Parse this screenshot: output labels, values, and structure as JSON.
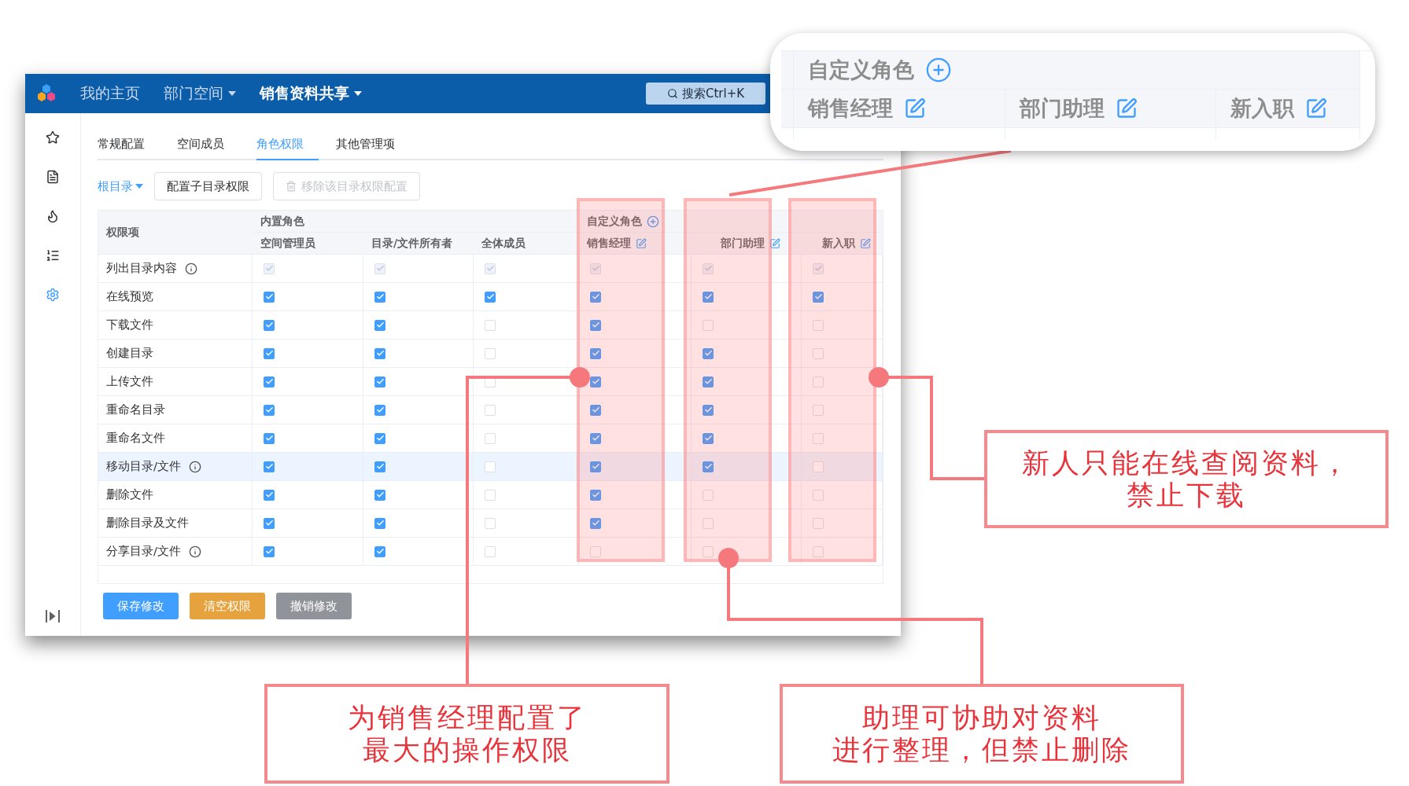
{
  "header": {
    "nav": [
      {
        "label": "我的主页",
        "selected": false,
        "dropdown": false
      },
      {
        "label": "部门空间",
        "selected": false,
        "dropdown": true
      },
      {
        "label": "销售资料共享",
        "selected": true,
        "dropdown": true
      }
    ],
    "search": "搜索Ctrl+K"
  },
  "sidebar": {
    "items": [
      {
        "kind": "star",
        "selected": false
      },
      {
        "kind": "document",
        "selected": false
      },
      {
        "kind": "flame",
        "selected": false
      },
      {
        "kind": "list",
        "selected": false
      },
      {
        "kind": "settings",
        "selected": true
      }
    ]
  },
  "tabs": [
    {
      "label": "常规配置",
      "selected": false
    },
    {
      "label": "空间成员",
      "selected": false
    },
    {
      "label": "角色权限",
      "selected": true
    },
    {
      "label": "其他管理项",
      "selected": false
    }
  ],
  "toolbar": {
    "directory": "根目录",
    "buttons": [
      {
        "label": "配置子目录权限",
        "disabled": false
      },
      {
        "label": "移除该目录权限配置",
        "disabled": true
      }
    ]
  },
  "table": {
    "row_header": "权限项",
    "groups": [
      {
        "title": "内置角色",
        "kind": "builtin"
      },
      {
        "title": "自定义角色",
        "kind": "custom"
      }
    ],
    "columns": [
      {
        "label": "空间管理员",
        "kind": "builtin",
        "highlighted": false
      },
      {
        "label": "目录/文件所有者",
        "kind": "builtin",
        "highlighted": false
      },
      {
        "label": "全体成员",
        "kind": "builtin",
        "highlighted": false
      },
      {
        "label": "销售经理",
        "kind": "custom",
        "highlighted": true
      },
      {
        "label": "部门助理",
        "kind": "custom",
        "highlighted": true
      },
      {
        "label": "新入职",
        "kind": "custom",
        "highlighted": true
      }
    ],
    "rows": [
      {
        "label": "列出目录内容",
        "info": true,
        "highlighted": false,
        "disabled": true,
        "checks": [
          true,
          true,
          true,
          true,
          true,
          true
        ]
      },
      {
        "label": "在线预览",
        "info": false,
        "highlighted": false,
        "disabled": false,
        "checks": [
          true,
          true,
          true,
          true,
          true,
          true
        ]
      },
      {
        "label": "下载文件",
        "info": false,
        "highlighted": false,
        "disabled": false,
        "checks": [
          true,
          true,
          false,
          true,
          false,
          false
        ]
      },
      {
        "label": "创建目录",
        "info": false,
        "highlighted": false,
        "disabled": false,
        "checks": [
          true,
          true,
          false,
          true,
          true,
          false
        ]
      },
      {
        "label": "上传文件",
        "info": false,
        "highlighted": false,
        "disabled": false,
        "checks": [
          true,
          true,
          false,
          true,
          true,
          false
        ]
      },
      {
        "label": "重命名目录",
        "info": false,
        "highlighted": false,
        "disabled": false,
        "checks": [
          true,
          true,
          false,
          true,
          true,
          false
        ]
      },
      {
        "label": "重命名文件",
        "info": false,
        "highlighted": false,
        "disabled": false,
        "checks": [
          true,
          true,
          false,
          true,
          true,
          false
        ]
      },
      {
        "label": "移动目录/文件",
        "info": true,
        "highlighted": true,
        "disabled": false,
        "checks": [
          true,
          true,
          false,
          true,
          true,
          false
        ]
      },
      {
        "label": "删除文件",
        "info": false,
        "highlighted": false,
        "disabled": false,
        "checks": [
          true,
          true,
          false,
          true,
          false,
          false
        ]
      },
      {
        "label": "删除目录及文件",
        "info": false,
        "highlighted": false,
        "disabled": false,
        "checks": [
          true,
          true,
          false,
          true,
          false,
          false
        ]
      },
      {
        "label": "分享目录/文件",
        "info": true,
        "highlighted": false,
        "disabled": false,
        "checks": [
          true,
          true,
          false,
          false,
          false,
          false
        ]
      }
    ]
  },
  "actions": [
    {
      "label": "保存修改",
      "kind": "primary"
    },
    {
      "label": "清空权限",
      "kind": "warning"
    },
    {
      "label": "撤销修改",
      "kind": "info"
    }
  ],
  "callout": {
    "group_title": "自定义角色",
    "roles": [
      "销售经理",
      "部门助理",
      "新入职"
    ]
  },
  "annotations": [
    {
      "lines": [
        "新人只能在线查阅资料，",
        "禁止下载"
      ]
    },
    {
      "lines": [
        "为销售经理配置了",
        "最大的操作权限"
      ]
    },
    {
      "lines": [
        "助理可协助对资料",
        "进行整理，但禁止删除"
      ]
    }
  ]
}
